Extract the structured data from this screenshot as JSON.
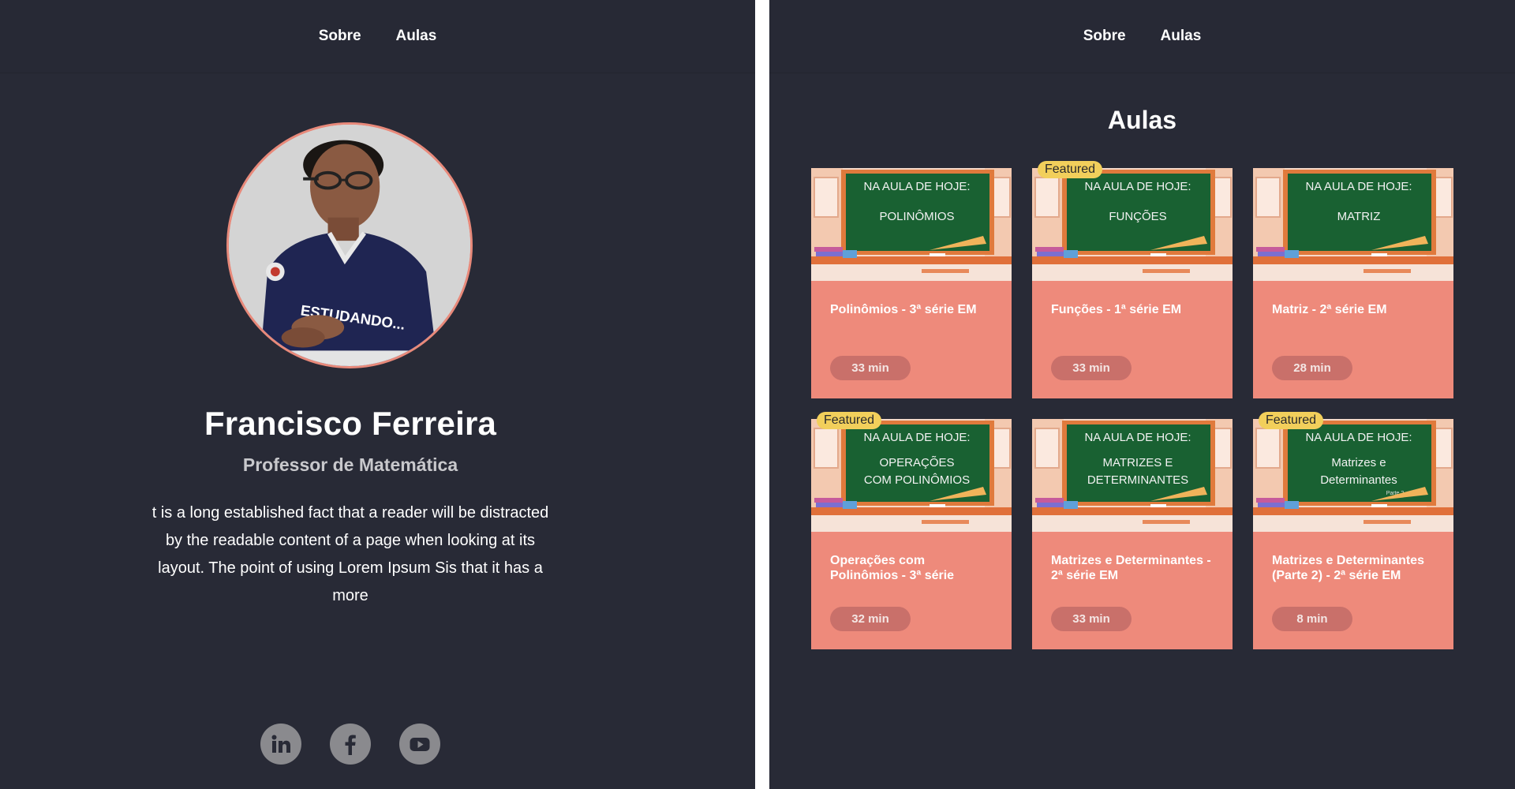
{
  "nav": {
    "about_label": "Sobre",
    "lessons_label": "Aulas"
  },
  "profile": {
    "name": "Francisco Ferreira",
    "role": "Professor de Matemática",
    "bio": "t is a long established fact that a reader will be distracted by the readable content of a page when looking at its layout. The point of using Lorem Ipsum Sis that it has a more",
    "shirt_text": "ESTUDANDO...",
    "socials": [
      "linkedin-icon",
      "facebook-icon",
      "youtube-icon"
    ]
  },
  "lessons": {
    "title": "Aulas",
    "thumb_header": "NA AULA DE HOJE:",
    "featured_label": "Featured",
    "cards": [
      {
        "title": "Polinômios - 3ª série EM",
        "duration": "33 min",
        "featured": false,
        "board": [
          "POLINÔMIOS"
        ]
      },
      {
        "title": "Funções - 1ª série EM",
        "duration": "33 min",
        "featured": true,
        "board": [
          "FUNÇÕES"
        ]
      },
      {
        "title": "Matriz - 2ª série EM",
        "duration": "28 min",
        "featured": false,
        "board": [
          "MATRIZ"
        ]
      },
      {
        "title": "Operações com Polinômios - 3ª série",
        "duration": "32 min",
        "featured": true,
        "board": [
          "OPERAÇÕES",
          "COM POLINÔMIOS"
        ]
      },
      {
        "title": "Matrizes e Determinantes - 2ª série EM",
        "duration": "33 min",
        "featured": false,
        "board": [
          "MATRIZES E",
          "DETERMINANTES"
        ]
      },
      {
        "title": "Matrizes e Determinantes (Parte 2) - 2ª série EM",
        "duration": "8 min",
        "featured": true,
        "board": [
          "Matrizes e",
          "Determinantes"
        ],
        "board_note": "Parte 2"
      }
    ]
  },
  "colors": {
    "background": "#282a36",
    "accent": "#ee8a7b",
    "badge": "#f2cf5b",
    "chalkboard": "#1f6b3a"
  }
}
